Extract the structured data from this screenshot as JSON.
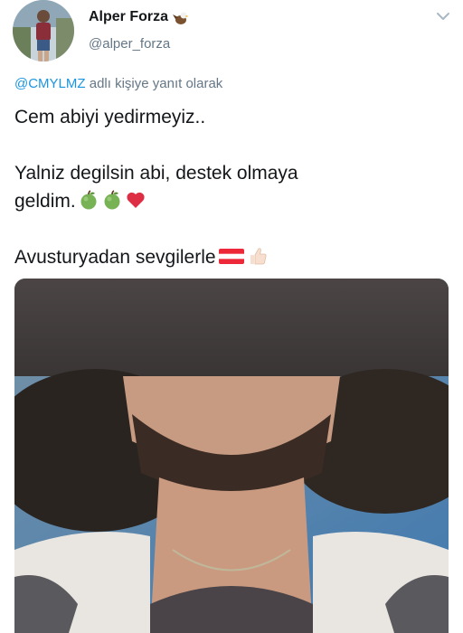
{
  "user": {
    "display_name": "Alper Forza",
    "handle": "@alper_forza"
  },
  "reply": {
    "mention": "@CMYLMZ",
    "suffix": "adlı kişiye yanıt olarak"
  },
  "tweet": {
    "line1": "Cem abiyi yedirmeyiz..",
    "line2a": "Yalniz degilsin abi, destek olmaya",
    "line2b": "geldim.",
    "line3": "Avusturyadan sevgilerle"
  },
  "icons": {
    "name_badge": "eagle-emoji",
    "menu": "chevron-down-icon",
    "emoji_apple": "green-apple-emoji",
    "emoji_heart": "red-heart-emoji",
    "emoji_flag": "austria-flag-emoji",
    "emoji_thumb": "thumbs-up-emoji"
  },
  "colors": {
    "mention": "#1b95e0",
    "muted": "#657786",
    "text": "#14171a"
  }
}
